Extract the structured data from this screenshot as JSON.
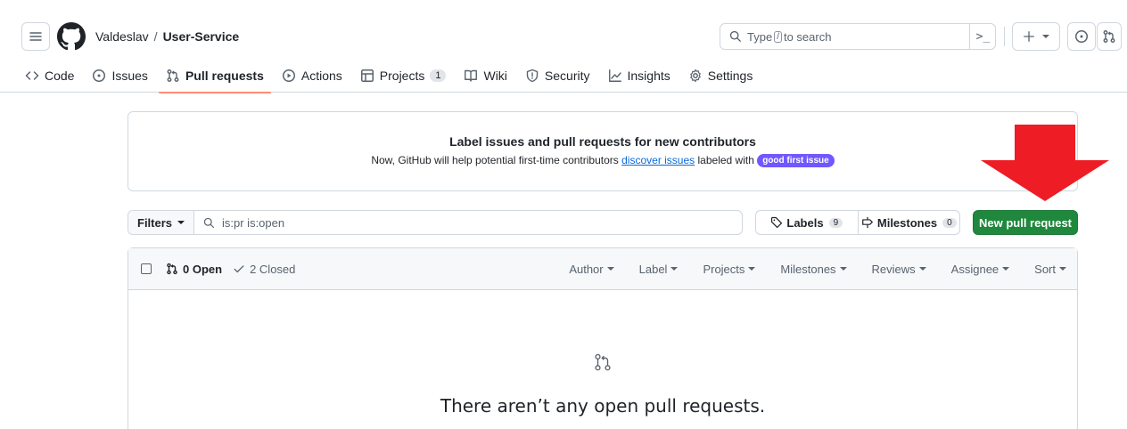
{
  "header": {
    "owner": "Valdeslav",
    "separator": "/",
    "repo": "User-Service",
    "search_placeholder_prefix": "Type",
    "search_kbd": "/",
    "search_placeholder_suffix": "to search",
    "command_glyph": ">_"
  },
  "tabs": [
    {
      "label": "Code",
      "icon": "code-icon"
    },
    {
      "label": "Issues",
      "icon": "issue-opened-icon"
    },
    {
      "label": "Pull requests",
      "icon": "git-pull-request-icon",
      "active": true
    },
    {
      "label": "Actions",
      "icon": "play-icon"
    },
    {
      "label": "Projects",
      "icon": "table-icon",
      "count": "1"
    },
    {
      "label": "Wiki",
      "icon": "book-icon"
    },
    {
      "label": "Security",
      "icon": "shield-icon"
    },
    {
      "label": "Insights",
      "icon": "graph-icon"
    },
    {
      "label": "Settings",
      "icon": "gear-icon"
    }
  ],
  "banner": {
    "title": "Label issues and pull requests for new contributors",
    "text_before": "Now, GitHub will help potential first-time contributors",
    "link": "discover issues",
    "text_after": "labeled with",
    "label": "good first issue"
  },
  "toolbar": {
    "filters": "Filters",
    "query": "is:pr is:open",
    "labels": "Labels",
    "labels_count": "9",
    "milestones": "Milestones",
    "milestones_count": "0",
    "new_pr": "New pull request"
  },
  "list": {
    "open": "0 Open",
    "closed": "2 Closed",
    "menus": [
      "Author",
      "Label",
      "Projects",
      "Milestones",
      "Reviews",
      "Assignee",
      "Sort"
    ],
    "empty_title": "There aren’t any open pull requests."
  },
  "colors": {
    "accent_tab": "#fd8c73",
    "primary_button": "#1f883d",
    "link": "#0969da",
    "good_first_issue": "#7057ff",
    "annotation_arrow": "#ee1c24"
  }
}
